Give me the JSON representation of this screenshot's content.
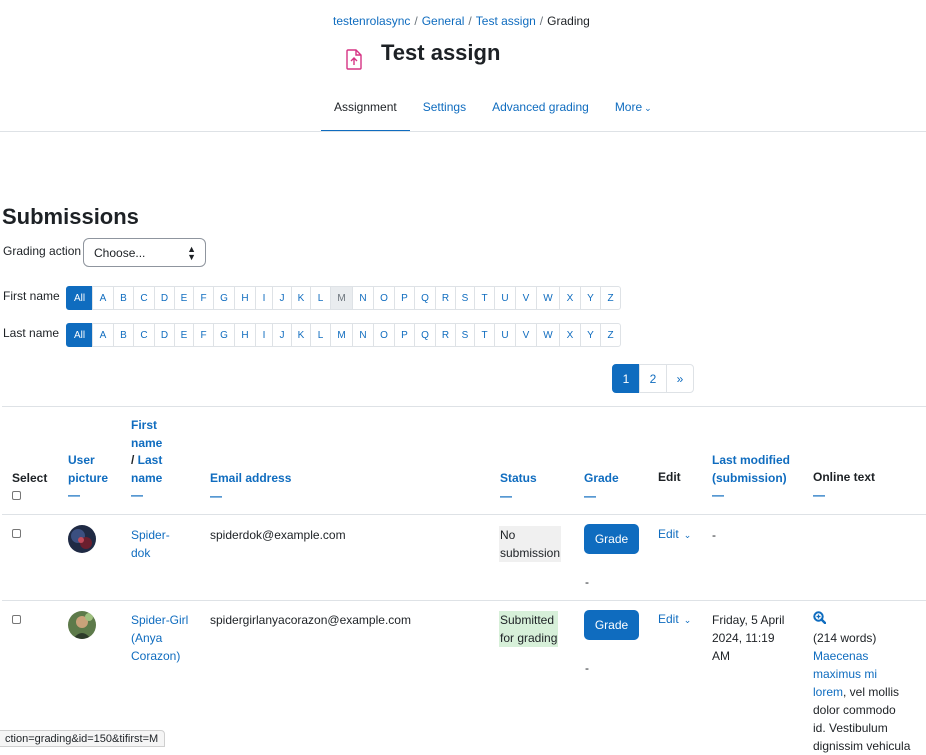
{
  "breadcrumb": [
    "testenrolasync",
    "General",
    "Test assign",
    "Grading"
  ],
  "page": {
    "title": "Test assign"
  },
  "tabs": [
    {
      "label": "Assignment",
      "active": true
    },
    {
      "label": "Settings"
    },
    {
      "label": "Advanced grading"
    },
    {
      "label": "More"
    }
  ],
  "submissions": {
    "heading": "Submissions",
    "grading_action_label": "Grading action",
    "grading_action_value": "Choose..."
  },
  "filters": {
    "first_name_label": "First name",
    "last_name_label": "Last name",
    "all_label": "All",
    "letters": [
      "A",
      "B",
      "C",
      "D",
      "E",
      "F",
      "G",
      "H",
      "I",
      "J",
      "K",
      "L",
      "M",
      "N",
      "O",
      "P",
      "Q",
      "R",
      "S",
      "T",
      "U",
      "V",
      "W",
      "X",
      "Y",
      "Z"
    ],
    "first_selected": "M",
    "last_selected": "All"
  },
  "pagination": [
    "1",
    "2",
    "»"
  ],
  "table": {
    "headers": {
      "select": "Select",
      "user_picture_1": "User",
      "user_picture_2": "picture",
      "name_1": "First",
      "name_2": "name",
      "name_3": "/ ",
      "name_4": "Last",
      "name_5": "name",
      "email": "Email address",
      "status": "Status",
      "grade": "Grade",
      "edit": "Edit",
      "last_modified_1": "Last modified",
      "last_modified_2": "(submission)",
      "online_text": "Online text",
      "sort_dash": "—"
    },
    "rows": [
      {
        "name_1": "Spider-",
        "name_2": "dok",
        "email": "spiderdok@example.com",
        "status_1": "No",
        "status_2": "submission",
        "grade_button": "Grade",
        "grade_value": "-",
        "edit": "Edit",
        "last_modified": "-"
      },
      {
        "name_1": "Spider-Girl",
        "name_2": "(Anya",
        "name_3": "Corazon)",
        "email": "spidergirlanyacorazon@example.com",
        "status_1": "Submitted",
        "status_2": "for grading",
        "grade_button": "Grade",
        "grade_value": "-",
        "edit": "Edit",
        "last_modified_1": "Friday, 5 April",
        "last_modified_2": "2024, 11:19",
        "last_modified_3": "AM",
        "online_words": "(214 words)",
        "online_link_1": "Maecenas",
        "online_link_2": "maximus mi",
        "online_link_3": "lorem",
        "online_rest_1": ", vel mollis",
        "online_rest_2": "dolor commodo",
        "online_rest_3": "id. Vestibulum",
        "online_rest_4": "dignissim vehicula"
      }
    ]
  },
  "statusbar_url": "ction=grading&id=150&tifirst=M",
  "colors": {
    "accent": "#0f6cbf",
    "no_submission_bg": "#f0f0f0",
    "submitted_bg": "#d7f0d9",
    "icon_pink": "#d63384"
  }
}
